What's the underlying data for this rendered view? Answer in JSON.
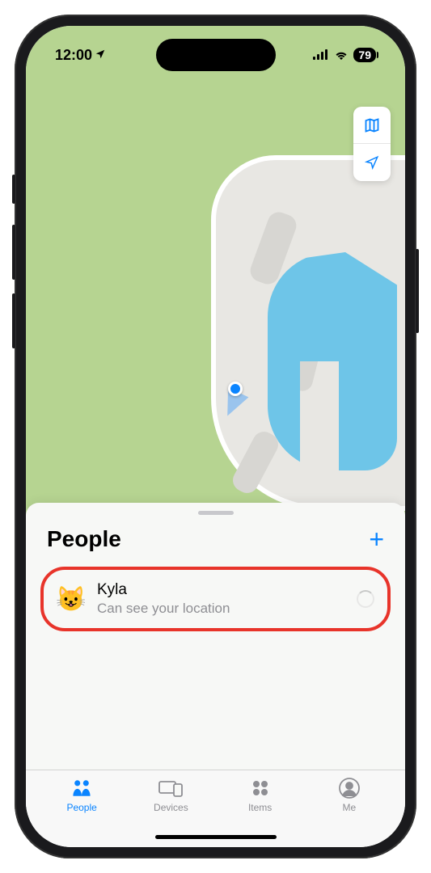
{
  "status_bar": {
    "time": "12:00",
    "battery": "79"
  },
  "map_controls": {
    "map_mode_icon": "map-icon",
    "locate_icon": "location-arrow-icon"
  },
  "sheet": {
    "title": "People",
    "add_label": "+",
    "people": [
      {
        "avatar_emoji": "😺",
        "name": "Kyla",
        "subtitle": "Can see your location",
        "loading": true
      }
    ]
  },
  "tabs": [
    {
      "id": "people",
      "label": "People",
      "active": true
    },
    {
      "id": "devices",
      "label": "Devices",
      "active": false
    },
    {
      "id": "items",
      "label": "Items",
      "active": false
    },
    {
      "id": "me",
      "label": "Me",
      "active": false
    }
  ]
}
